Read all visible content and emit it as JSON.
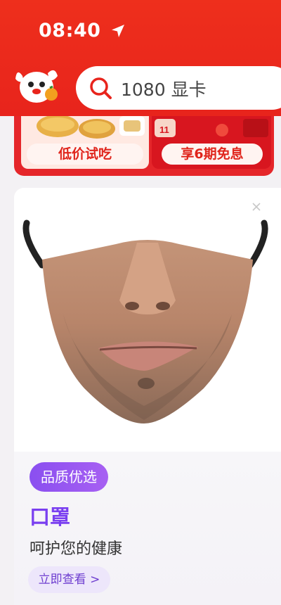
{
  "status_bar": {
    "time": "08:40"
  },
  "search": {
    "query": "1080 显卡"
  },
  "promos": {
    "left_label": "低价试吃",
    "right_label": "享6期免息"
  },
  "product_card": {
    "badge": "品质优选",
    "title": "口罩",
    "subtitle": "呵护您的健康",
    "cta": "立即查看 >"
  },
  "colors": {
    "header_red": "#e8241c",
    "badge_purple": "#8a4ff0",
    "title_purple": "#7a3ff0"
  },
  "icons": [
    "location-arrow-icon",
    "search-icon",
    "close-icon"
  ]
}
